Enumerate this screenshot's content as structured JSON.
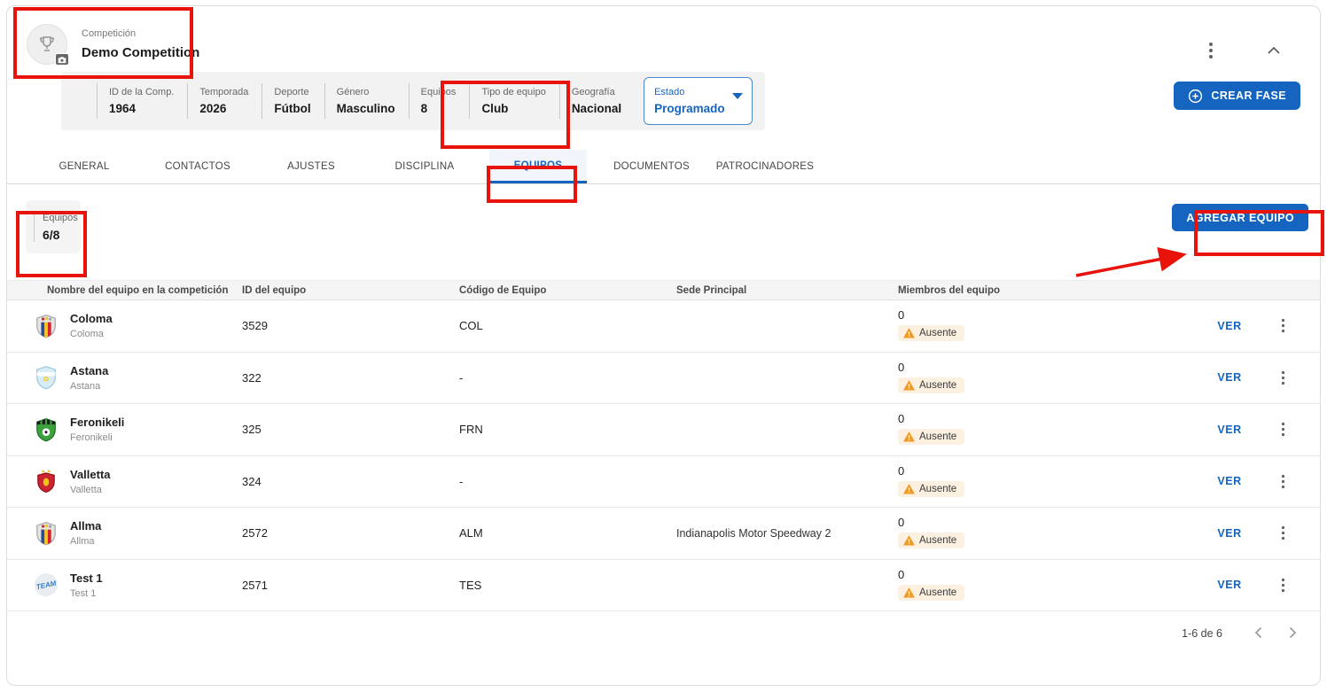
{
  "header": {
    "overline": "Competición",
    "title": "Demo Competition"
  },
  "info_bar": {
    "items": [
      {
        "label": "ID de la Comp.",
        "value": "1964"
      },
      {
        "label": "Temporada",
        "value": "2026"
      },
      {
        "label": "Deporte",
        "value": "Fútbol"
      },
      {
        "label": "Género",
        "value": "Masculino"
      },
      {
        "label": "Equipos",
        "value": "8"
      },
      {
        "label": "Tipo de equipo",
        "value": "Club"
      },
      {
        "label": "Geografía",
        "value": "Nacional"
      }
    ]
  },
  "estado": {
    "label": "Estado",
    "value": "Programado"
  },
  "actions": {
    "crear_fase": "CREAR FASE",
    "agregar_equipo": "AGREGAR EQUIPO",
    "ver": "VER"
  },
  "tabs": [
    {
      "label": "GENERAL",
      "active": false
    },
    {
      "label": "CONTACTOS",
      "active": false
    },
    {
      "label": "AJUSTES",
      "active": false
    },
    {
      "label": "DISCIPLINA",
      "active": false
    },
    {
      "label": "EQUIPOS",
      "active": true
    },
    {
      "label": "DOCUMENTOS",
      "active": false
    },
    {
      "label": "PATROCINADORES",
      "active": false
    }
  ],
  "summary": {
    "label": "Equipos",
    "value": "6/8"
  },
  "table": {
    "columns": [
      "Nombre del equipo en la competición",
      "ID del equipo",
      "Código de Equipo",
      "Sede Principal",
      "Miembros del equipo"
    ],
    "rows": [
      {
        "name": "Coloma",
        "subtitle": "Coloma",
        "id": "3529",
        "code": "COL",
        "venue": "",
        "members": "0",
        "status": "Ausente"
      },
      {
        "name": "Astana",
        "subtitle": "Astana",
        "id": "322",
        "code": "-",
        "venue": "",
        "members": "0",
        "status": "Ausente"
      },
      {
        "name": "Feronikeli",
        "subtitle": "Feronikeli",
        "id": "325",
        "code": "FRN",
        "venue": "",
        "members": "0",
        "status": "Ausente"
      },
      {
        "name": "Valletta",
        "subtitle": "Valletta",
        "id": "324",
        "code": "-",
        "venue": "",
        "members": "0",
        "status": "Ausente"
      },
      {
        "name": "Allma",
        "subtitle": "Allma",
        "id": "2572",
        "code": "ALM",
        "venue": "Indianapolis Motor Speedway 2",
        "members": "0",
        "status": "Ausente"
      },
      {
        "name": "Test 1",
        "subtitle": "Test 1",
        "id": "2571",
        "code": "TES",
        "venue": "",
        "members": "0",
        "status": "Ausente"
      }
    ]
  },
  "pagination": {
    "range": "1-6 de 6"
  },
  "colors": {
    "accent": "#1565c0",
    "annotation_red": "#e8130a",
    "ausente_badge_bg": "#fcf1e0",
    "warning_orange": "#ef9a28",
    "info_bar_bg": "#f2f2f2"
  },
  "icons": {
    "trophy-icon": "trophy outline",
    "camera-icon": "camera",
    "kebab-icon": "⋮",
    "chevron-up-icon": "^",
    "caret-down-icon": "▼",
    "plus-circle-icon": "⊕",
    "warning-icon": "⚠",
    "chevron-left-icon": "‹",
    "chevron-right-icon": "›"
  }
}
